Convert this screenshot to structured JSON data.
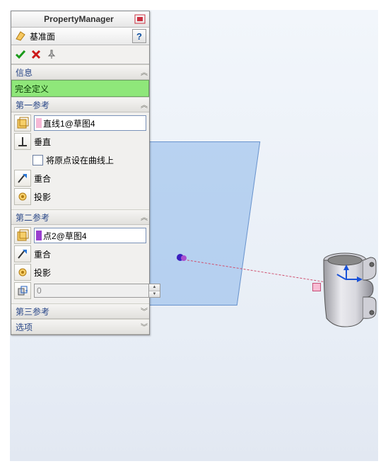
{
  "header": {
    "title": "PropertyManager"
  },
  "feature": {
    "icon_name": "plane-icon",
    "label": "基准面",
    "help_label": "?"
  },
  "confirm_bar": {
    "ok_icon": "ok-check-icon",
    "cancel_icon": "cancel-x-icon",
    "pin_icon": "pushpin-icon"
  },
  "sections": {
    "info": {
      "title": "信息",
      "status": "完全定义"
    },
    "ref1": {
      "title": "第一参考",
      "entity": "直线1@草图4",
      "swatch_color": "#f6b8d5",
      "perpendicular_label": "垂直",
      "origin_on_curve_label": "将原点设在曲线上",
      "coincident_label": "重合",
      "project_label": "投影"
    },
    "ref2": {
      "title": "第二参考",
      "entity": "点2@草图4",
      "swatch_color": "#9a3fcf",
      "coincident_label": "重合",
      "project_label": "投影",
      "offset_value": "0"
    },
    "ref3": {
      "title": "第三参考"
    },
    "options": {
      "title": "选项"
    }
  }
}
